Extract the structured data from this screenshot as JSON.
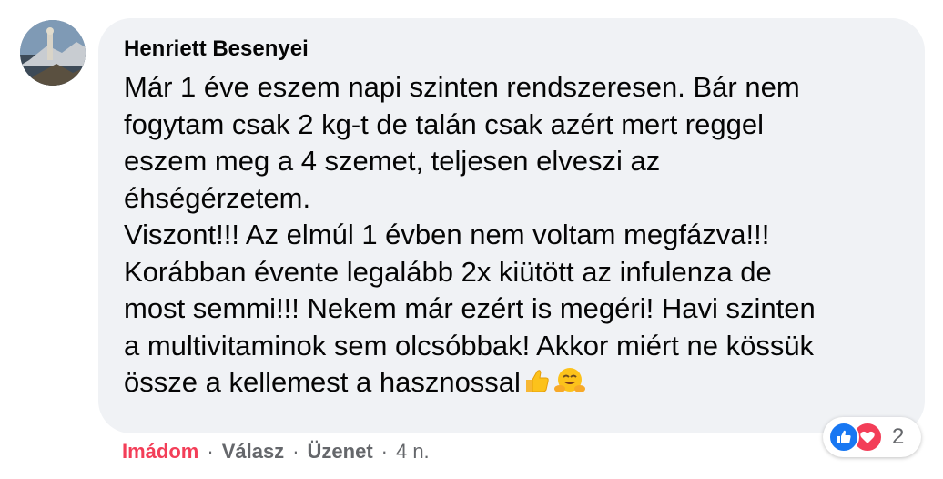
{
  "comment": {
    "author": "Henriett Besenyei",
    "lines": [
      "Már 1 éve eszem napi szinten rendszeresen. Bár nem",
      "fogytam csak 2 kg-t de talán csak azért mert reggel",
      "eszem meg a 4 szemet, teljesen elveszi az",
      "éhségérzetem.",
      "Viszont!!! Az elmúl 1 évben nem voltam megfázva!!!",
      "Korábban évente legalább 2x kiütött az infulenza de",
      "most semmi!!! Nekem már ezért is megéri! Havi szinten",
      "a multivitaminok sem olcsóbbak! Akkor miért ne kössük",
      "össze a kellemest a hasznossal"
    ],
    "trailing_emojis": [
      "thumbs-up-icon",
      "hugging-face-icon"
    ]
  },
  "reactions": {
    "icons": [
      "like-icon",
      "love-icon"
    ],
    "count": "2"
  },
  "actions": {
    "love_label": "Imádom",
    "reply_label": "Válasz",
    "message_label": "Üzenet",
    "separator": "·",
    "time": "4 n."
  },
  "colors": {
    "bubble": "#f0f2f5",
    "text": "#050505",
    "secondary": "#65676b",
    "love": "#f33e58",
    "like": "#1877f2"
  }
}
